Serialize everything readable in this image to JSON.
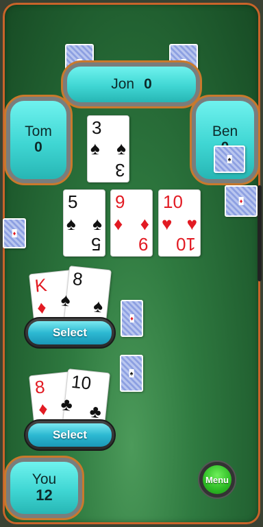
{
  "players": {
    "jon": {
      "name": "Jon",
      "score": "0"
    },
    "tom": {
      "name": "Tom",
      "score": "0"
    },
    "ben": {
      "name": "Ben",
      "score": "0"
    },
    "you": {
      "name": "You",
      "score": "12"
    }
  },
  "table": {
    "top_card": {
      "rank": "3",
      "suit": "♠",
      "color": "#111111"
    },
    "center_cards": [
      {
        "rank": "5",
        "suit": "♠"
      },
      {
        "rank": "9",
        "suit": "♦"
      },
      {
        "rank": "10",
        "suit": "♥"
      }
    ]
  },
  "hand_upper": {
    "cards": [
      {
        "rank": "K",
        "suit": "♦"
      },
      {
        "rank": "8",
        "suit": "♠"
      }
    ],
    "select_label": "Select"
  },
  "hand_lower": {
    "cards": [
      {
        "rank": "8",
        "suit": "♦"
      },
      {
        "rank": "10",
        "suit": "♣"
      }
    ],
    "select_label": "Select"
  },
  "menu": {
    "label": "Menu"
  },
  "colors": {
    "felt": "#2f7a40",
    "accent": "#c9792c",
    "panel": "#3fd6d3",
    "red_suit": "#e21b23"
  }
}
